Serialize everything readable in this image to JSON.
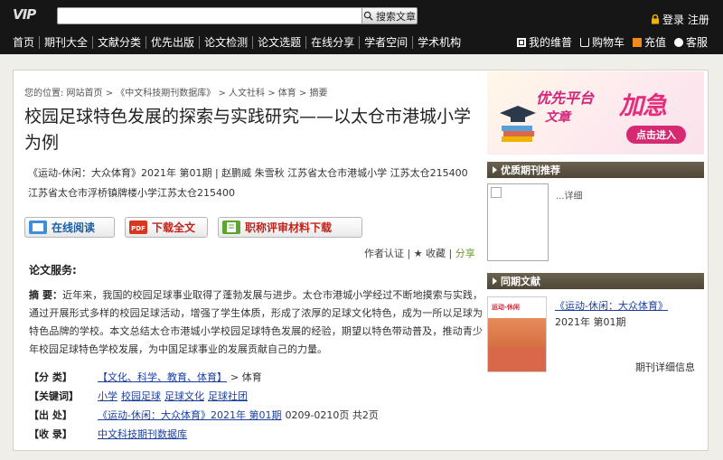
{
  "header": {
    "logo": "VIP",
    "search_button": "搜索文章",
    "login": "登录 注册"
  },
  "nav": {
    "items": [
      "首页",
      "期刊大全",
      "文献分类",
      "优先出版",
      "论文检测",
      "论文选题",
      "在线分享",
      "学者空间",
      "学术机构"
    ],
    "right": [
      "我的维普",
      "购物车",
      "充值",
      "客服"
    ]
  },
  "article": {
    "breadcrumb": "您的位置: 网站首页 > 《中文科技期刊数据库》 > 人文社科 > 体育 > 摘要",
    "title": "校园足球特色发展的探索与实践研究——以太仓市港城小学为例",
    "meta_line1": "《运动-休闲：大众体育》2021年 第01期 | 赵鹏威 朱雪秋   江苏省太仓市港城小学 江苏太仓215400",
    "meta_line2": "江苏省太仓市浮桥镇牌楼小学江苏太仓215400",
    "btn_read": "在线阅读",
    "btn_download": "下载全文",
    "btn_material": "职称评审材料下载",
    "author_cert": "作者认证",
    "favorite": "★ 收藏",
    "share": "分享",
    "service_label": "论文服务:",
    "abstract_label": "摘    要：",
    "abstract_text": "近年来，我国的校园足球事业取得了蓬勃发展与进步。太仓市港城小学经过不断地摸索与实践，通过开展形式多样的校园足球活动，增强了学生体质，形成了浓厚的足球文化特色，成为一所以足球为特色品牌的学校。本文总结太仓市港城小学校园足球特色发展的经验，期望以特色带动普及，推动青少年校园足球特色学校发展，为中国足球事业的发展贡献自己的力量。",
    "class_label": "【分    类】",
    "class_link": "【文化、科学、教育、体育】",
    "class_rest": "> 体育",
    "kw_label": "【关键词】",
    "keywords": [
      "小学",
      "校园足球",
      "足球文化",
      "足球社团"
    ],
    "source_label": "【出    处】",
    "source_link": "《运动-休闲：大众体育》2021年 第01期",
    "source_rest": "0209-0210页 共2页",
    "collect_label": "【收    录】",
    "collect_link": "中文科技期刊数据库"
  },
  "sidebar": {
    "banner_t1": "优先平台",
    "banner_t2": "文章",
    "banner_t3": "加急",
    "banner_enter": "点击进入",
    "pick_title": "优质期刊推荐",
    "pick_more": "...详细",
    "same_title": "同期文献",
    "cover_text": "运动-休闲",
    "journal_name": "《运动-休闲：大众体育》",
    "journal_issue": "2021年 第01期",
    "journal_detail": "期刊详细信息"
  }
}
